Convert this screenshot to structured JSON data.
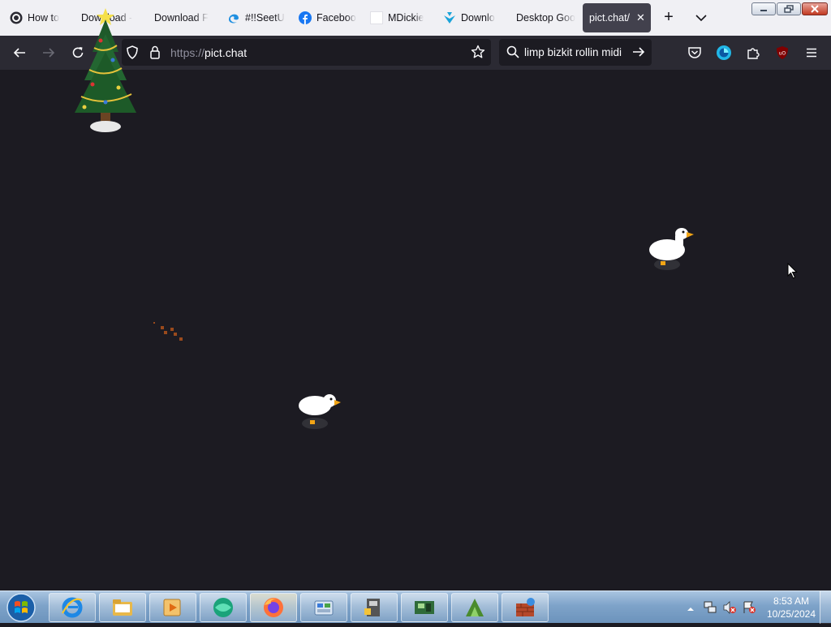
{
  "browser": {
    "tabs": [
      {
        "label": "How to",
        "icon": "obs-icon",
        "active": false
      },
      {
        "label": "Download -",
        "icon": "christmas-tree-icon",
        "active": false
      },
      {
        "label": "Download F",
        "icon": "none",
        "active": false
      },
      {
        "label": "#!!SeetU",
        "icon": "edge-icon",
        "active": false
      },
      {
        "label": "Faceboo",
        "icon": "facebook-icon",
        "active": false
      },
      {
        "label": "MDickie",
        "icon": "blank-page-icon",
        "active": false
      },
      {
        "label": "Downlo",
        "icon": "download-arrow-icon",
        "active": false
      },
      {
        "label": "Desktop Goo",
        "icon": "none",
        "active": false
      },
      {
        "label": "pict.chat/",
        "icon": "none",
        "active": true
      }
    ],
    "new_tab_label": "+",
    "url_protocol": "https://",
    "url_host": "pict.chat",
    "search_query": "limp bizkit rollin midi"
  },
  "desktop_goose": {
    "tree_icon": "christmas-tree-icon",
    "goose_icon": "goose-icon",
    "footprints_icon": "footprints-icon",
    "cursor_icon": "mouse-cursor-icon"
  },
  "taskbar": {
    "pinned": [
      "internet-explorer-icon",
      "file-explorer-icon",
      "media-player-icon",
      "green-globe-icon",
      "firefox-icon",
      "control-panel-icon",
      "game-app-icon",
      "pc-board-app-icon",
      "green-app-icon",
      "bricks-app-icon"
    ],
    "clock_time": "8:53 AM",
    "clock_date": "10/25/2024"
  },
  "colors": {
    "tab_strip": "#f0f0f4",
    "active_tab": "#42414d",
    "nav_bar": "#2b2a33",
    "page_background": "#1c1b22",
    "taskbar": "#7ea3c9"
  }
}
